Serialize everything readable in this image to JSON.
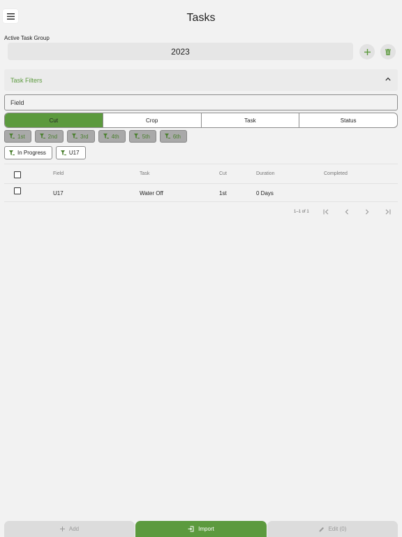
{
  "header": {
    "title": "Tasks"
  },
  "task_group": {
    "label": "Active Task Group",
    "selected": "2023"
  },
  "filters": {
    "title": "Task Filters",
    "field_placeholder": "Field",
    "segments": [
      {
        "label": "Cut",
        "active": true
      },
      {
        "label": "Crop",
        "active": false
      },
      {
        "label": "Task",
        "active": false
      },
      {
        "label": "Status",
        "active": false
      }
    ],
    "cut_chips": [
      "1st",
      "2nd",
      "3rd",
      "4th",
      "5th",
      "6th"
    ],
    "active_filters": [
      "In Progress",
      "U17"
    ]
  },
  "table": {
    "columns": [
      "Field",
      "Task",
      "Cut",
      "Duration",
      "Completed"
    ],
    "rows": [
      {
        "field": "U17",
        "task": "Water Off",
        "cut": "1st",
        "duration": "0 Days",
        "completed": ""
      }
    ],
    "pagination": "1–1 of 1"
  },
  "bottom_bar": {
    "add_label": "Add",
    "import_label": "Import",
    "edit_label": "Edit (0)"
  },
  "colors": {
    "accent": "#5c9a3e",
    "background": "#f2f2f2"
  },
  "icons": {
    "menu": "hamburger-icon",
    "add": "plus-icon",
    "delete": "trash-icon",
    "collapse": "chevron-up-icon",
    "filter": "filter-icon",
    "first": "first-page-icon",
    "prev": "chevron-left-icon",
    "next": "chevron-right-icon",
    "last": "last-page-icon",
    "import": "import-icon",
    "edit": "pencil-icon"
  }
}
